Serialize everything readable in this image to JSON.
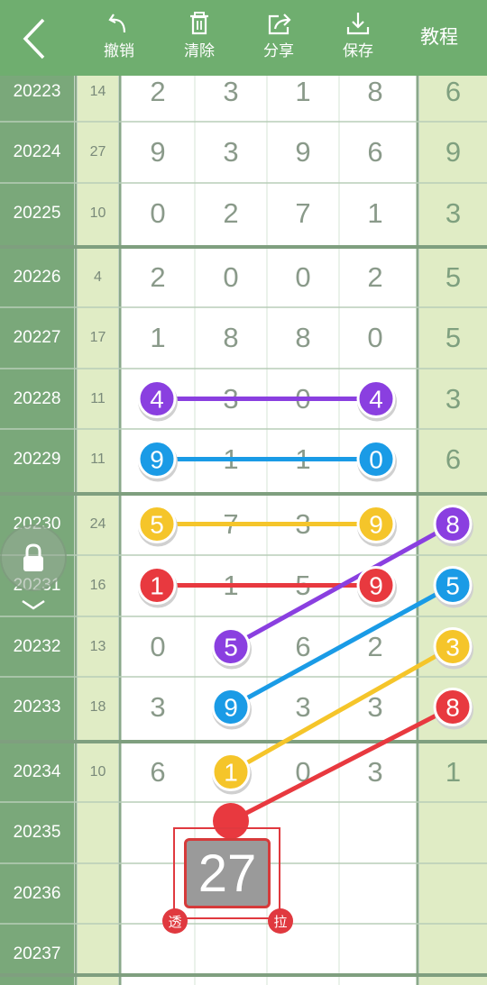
{
  "toolbar": {
    "undo_label": "撤销",
    "clear_label": "清除",
    "share_label": "分享",
    "save_label": "保存",
    "tutorial_label": "教程"
  },
  "rows": [
    {
      "issue": "20223",
      "sum": "14",
      "d": [
        "2",
        "3",
        "1",
        "8"
      ],
      "total": "6"
    },
    {
      "issue": "20224",
      "sum": "27",
      "d": [
        "9",
        "3",
        "9",
        "6"
      ],
      "total": "9"
    },
    {
      "issue": "20225",
      "sum": "10",
      "d": [
        "0",
        "2",
        "7",
        "1"
      ],
      "total": "3"
    },
    {
      "issue": "20226",
      "sum": "4",
      "d": [
        "2",
        "0",
        "0",
        "2"
      ],
      "total": "5"
    },
    {
      "issue": "20227",
      "sum": "17",
      "d": [
        "1",
        "8",
        "8",
        "0"
      ],
      "total": "5"
    },
    {
      "issue": "20228",
      "sum": "11",
      "d": [
        "4",
        "3",
        "0",
        "4"
      ],
      "total": "3"
    },
    {
      "issue": "20229",
      "sum": "11",
      "d": [
        "9",
        "1",
        "1",
        "0"
      ],
      "total": "6"
    },
    {
      "issue": "20230",
      "sum": "24",
      "d": [
        "5",
        "7",
        "3",
        "9"
      ],
      "total": "8"
    },
    {
      "issue": "20231",
      "sum": "16",
      "d": [
        "1",
        "1",
        "5",
        "9"
      ],
      "total": "5"
    },
    {
      "issue": "20232",
      "sum": "13",
      "d": [
        "0",
        "5",
        "6",
        "2"
      ],
      "total": "3"
    },
    {
      "issue": "20233",
      "sum": "18",
      "d": [
        "3",
        "9",
        "3",
        "3"
      ],
      "total": "8"
    },
    {
      "issue": "20234",
      "sum": "10",
      "d": [
        "6",
        "1",
        "0",
        "3"
      ],
      "total": "1"
    },
    {
      "issue": "20235",
      "sum": "",
      "d": [
        "",
        "",
        "",
        ""
      ],
      "total": ""
    },
    {
      "issue": "20236",
      "sum": "",
      "d": [
        "",
        "",
        "",
        ""
      ],
      "total": ""
    },
    {
      "issue": "20237",
      "sum": "",
      "d": [
        "",
        "",
        "",
        ""
      ],
      "total": ""
    }
  ],
  "colors": {
    "purple": "#8a3fe0",
    "blue": "#1a9be6",
    "yellow": "#f5c52a",
    "red": "#e8393f",
    "issue_column": "#7aa87a",
    "sum_column": "#e0ecc5",
    "toolbar": "#6fae6f"
  },
  "counter": {
    "value": "27",
    "left_tag": "透",
    "right_tag": "拉"
  },
  "icons": {
    "back": "chevron-left-icon",
    "undo": "undo-icon",
    "clear": "trash-icon",
    "share": "share-icon",
    "save": "download-icon",
    "lock": "lock-icon"
  }
}
